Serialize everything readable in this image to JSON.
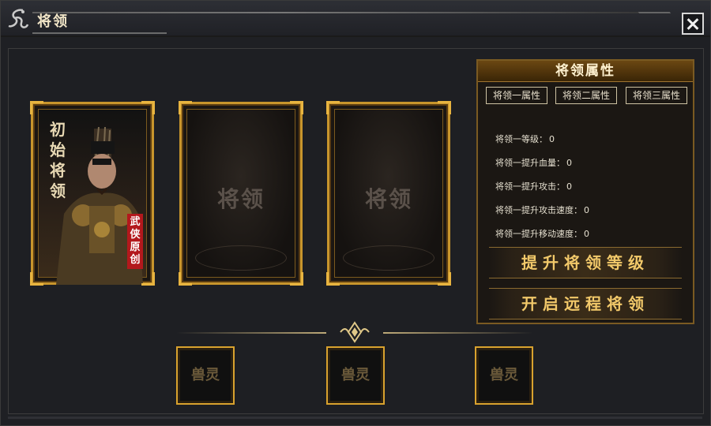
{
  "window": {
    "title": "将领",
    "close_icon": "close-icon",
    "title_icon": "dragon-emblem-icon"
  },
  "cards": [
    {
      "vertical_label": [
        "初",
        "始",
        "将",
        "领"
      ],
      "tag": [
        "武",
        "侠",
        "原",
        "创"
      ],
      "filled": true
    },
    {
      "placeholder": "将领",
      "filled": false
    },
    {
      "placeholder": "将领",
      "filled": false
    }
  ],
  "attributes": {
    "header": "将领属性",
    "tabs": [
      "将领一属性",
      "将领二属性",
      "将领三属性"
    ],
    "stats": [
      {
        "label": "将领一等级：",
        "value": "0"
      },
      {
        "label": "将领一提升血量：",
        "value": "0"
      },
      {
        "label": "将领一提升攻击：",
        "value": "0"
      },
      {
        "label": "将领一提升攻击速度：",
        "value": "0"
      },
      {
        "label": "将领一提升移动速度：",
        "value": "0"
      }
    ],
    "buttons": {
      "upgrade": "提升将领等级",
      "remote": "开启远程将领"
    }
  },
  "beast_slots": [
    "兽灵",
    "兽灵",
    "兽灵"
  ],
  "colors": {
    "gold": "#d9a22e",
    "panel_bg": "#1e1f23",
    "tag_red": "#b3181c"
  }
}
